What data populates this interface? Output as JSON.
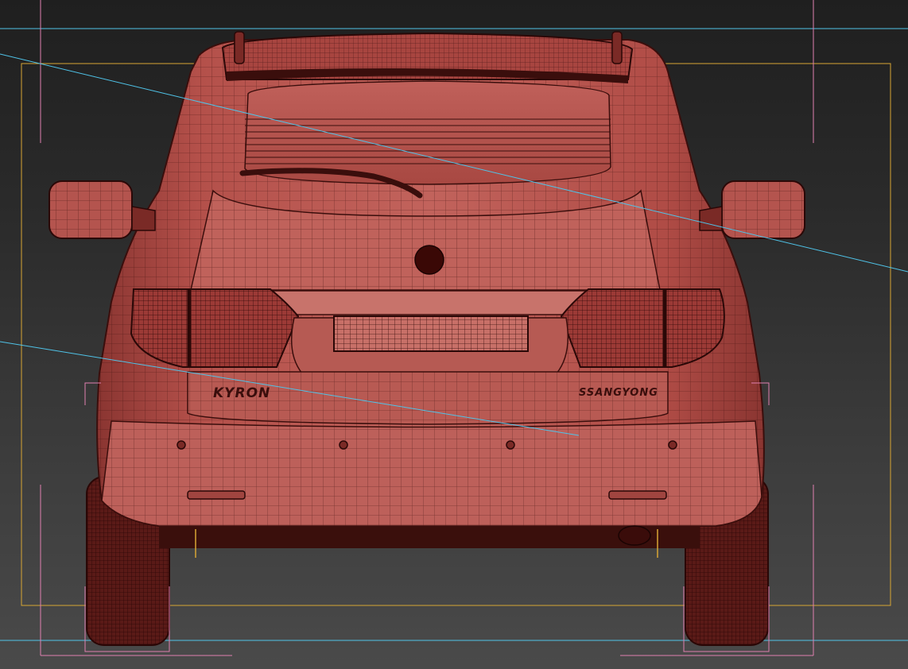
{
  "viewport": {
    "model": {
      "tailgate_badge": "KYRON",
      "brand_badge": "SSANGYONG"
    },
    "colors": {
      "background_top": "#1f1f1f",
      "background_bottom": "#4a4a4a",
      "car_body": "#b5504a",
      "wire": "#3a0e0c",
      "guide_cyan": "#4fc3e8",
      "safe_frame_yellow": "#d7a534",
      "corner_pink": "#e080b0"
    }
  }
}
